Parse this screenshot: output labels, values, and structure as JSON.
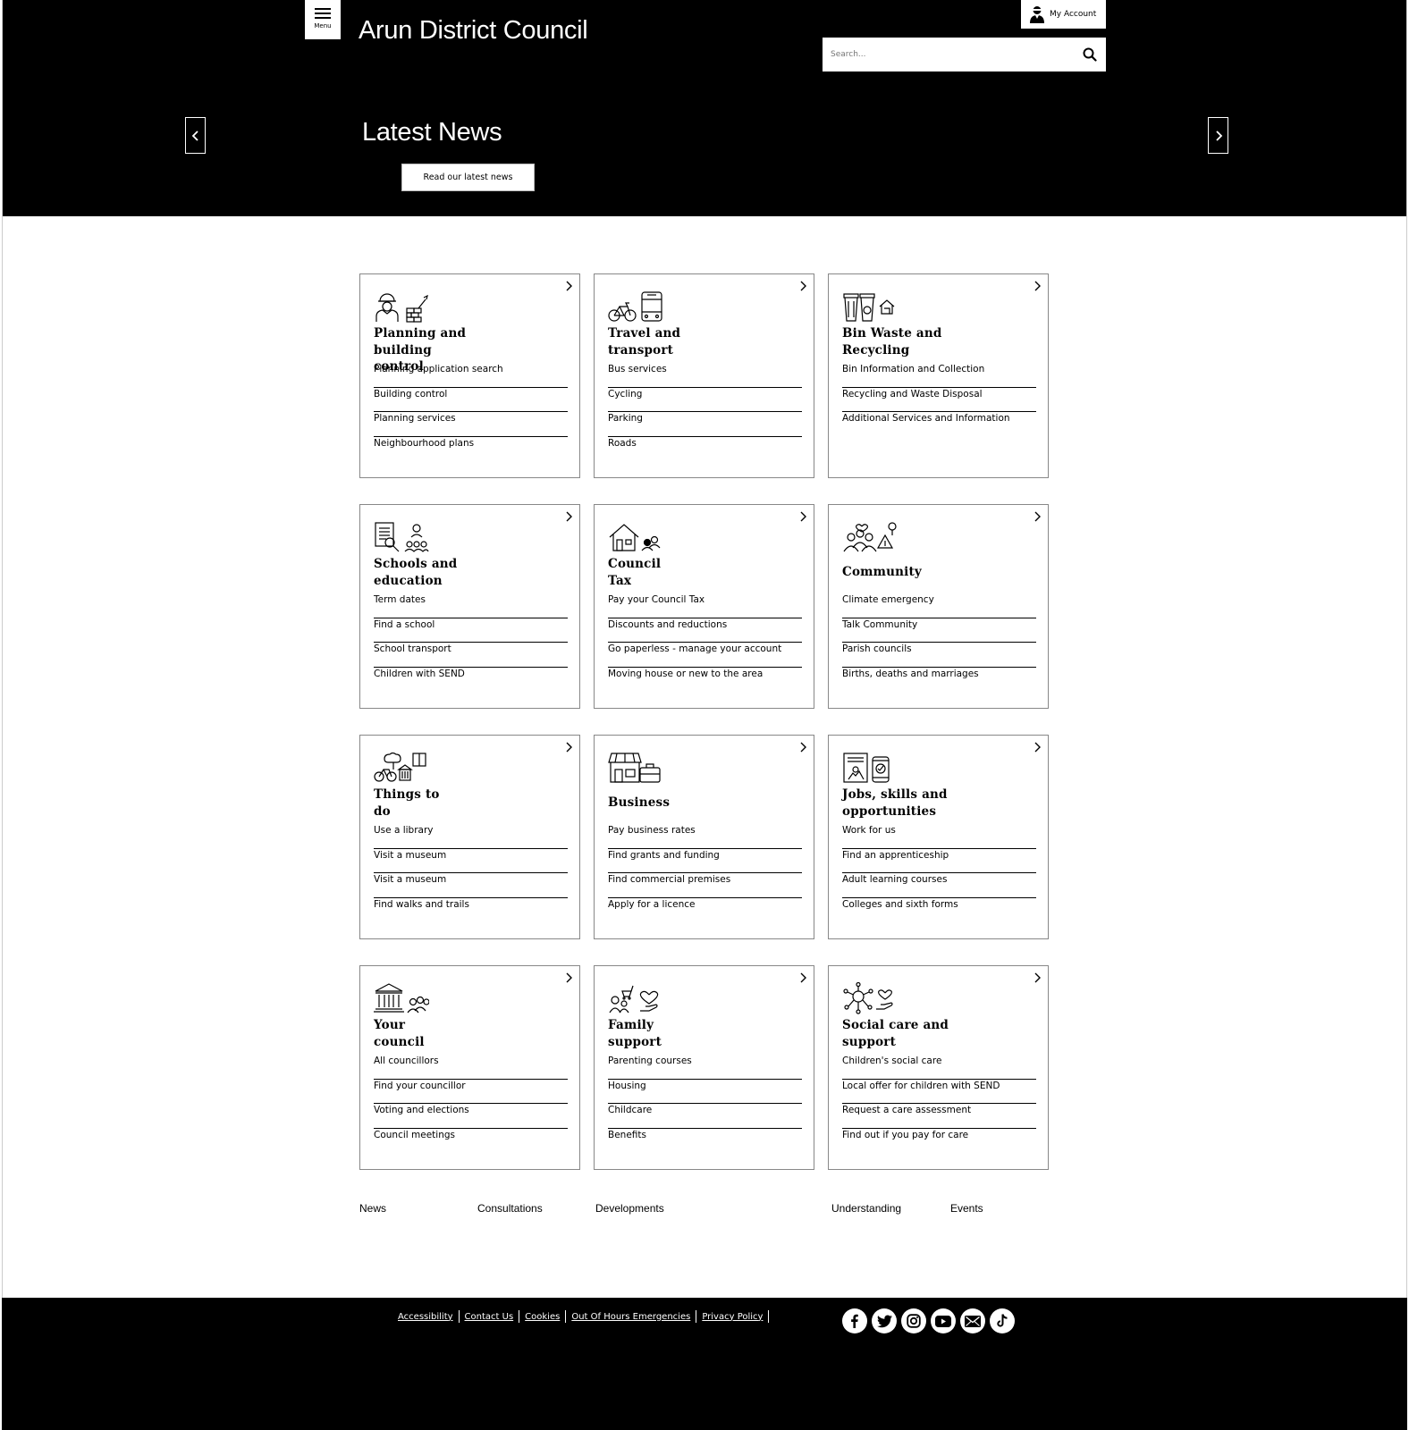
{
  "header": {
    "menu_label": "Menu",
    "site_title": "Arun District Council",
    "account_label": "My Account",
    "search_placeholder": "Search..."
  },
  "hero": {
    "title": "Latest News",
    "button_label": "Read our latest news"
  },
  "cards": [
    {
      "title": "Planning and building control",
      "icon": "planning-building-icon",
      "links": [
        "Planning application search",
        "Building control",
        "Planning services",
        "Neighbourhood plans"
      ]
    },
    {
      "title": "Travel and transport",
      "icon": "bike-bus-icon",
      "links": [
        "Bus services",
        "Cycling",
        "Parking",
        "Roads"
      ]
    },
    {
      "title": "Bin Waste and Recycling",
      "icon": "bins-icon",
      "links": [
        "Bin Information and Collection",
        "Recycling and Waste Disposal",
        "Additional Services and Information"
      ]
    },
    {
      "title": "Schools and education",
      "icon": "school-education-icon",
      "links": [
        "Term dates",
        "Find a school",
        "School transport",
        "Children with SEND"
      ]
    },
    {
      "title": "Council Tax",
      "icon": "house-people-icon",
      "links": [
        "Pay your Council Tax",
        "Discounts and reductions",
        "Go paperless - manage your account",
        "Moving house or new to the area"
      ]
    },
    {
      "title": "Community",
      "icon": "community-icon",
      "links": [
        "Climate emergency",
        "Talk Community",
        "Parish councils",
        "Births, deaths and marriages"
      ]
    },
    {
      "title": "Things to do",
      "icon": "leisure-icon",
      "links": [
        "Use a library",
        "Visit a museum",
        "Visit a museum",
        "Find walks and trails"
      ]
    },
    {
      "title": "Business",
      "icon": "shop-briefcase-icon",
      "links": [
        "Pay business rates",
        "Find grants and funding",
        "Find commercial premises",
        "Apply for a licence"
      ]
    },
    {
      "title": "Jobs, skills and opportunities",
      "icon": "jobs-icon",
      "links": [
        "Work for us",
        "Find an apprenticeship",
        "Adult learning courses",
        "Colleges and sixth forms"
      ]
    },
    {
      "title": "Your council",
      "icon": "council-building-icon",
      "links": [
        "All councillors",
        "Find your councillor",
        "Voting and elections",
        "Council meetings"
      ]
    },
    {
      "title": "Family support",
      "icon": "family-icon",
      "links": [
        "Parenting courses",
        "Housing",
        "Childcare",
        "Benefits"
      ]
    },
    {
      "title": "Social care and support",
      "icon": "social-care-icon",
      "links": [
        "Children's social care",
        "Local offer for children with SEND",
        "Request a care assessment",
        "Find out if you pay for care"
      ]
    }
  ],
  "bottom_links": [
    "News",
    "Consultations",
    "Developments",
    "Understanding",
    "Events"
  ],
  "footer": {
    "links": [
      "Accessibility",
      "Contact Us",
      "Cookies",
      "Out Of Hours Emergencies",
      "Privacy Policy"
    ],
    "social": [
      "facebook-icon",
      "twitter-icon",
      "instagram-icon",
      "youtube-icon",
      "email-icon",
      "tiktok-icon"
    ]
  },
  "colors": {
    "header_bg": "#000000",
    "footer_bg": "#000000",
    "card_border": "#888888"
  }
}
